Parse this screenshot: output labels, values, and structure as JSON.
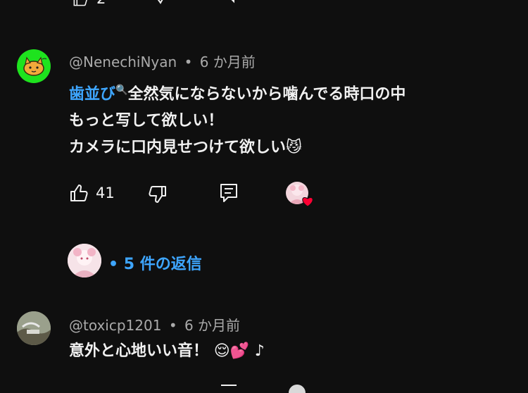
{
  "top_actions": {
    "like_count": "2"
  },
  "comments": [
    {
      "author": "@NenechiNyan",
      "separator": "•",
      "time": "6 か月前",
      "hashtag": "歯並び",
      "search_glyph": "🔍",
      "line1_rest": "全然気にならないから噛んでる時口の中",
      "line2": "もっと写して欲しい！",
      "line3": "カメラに口内見せつけて欲しい",
      "line3_emoji": "😼",
      "like_count": "41",
      "replies_label": "• 5 件の返信",
      "avatar_bg": "#1ee31e",
      "avatar_icon": "cat-icon",
      "heart_color": "#ff0033"
    },
    {
      "author": "@toxicp1201",
      "separator": "•",
      "time": "6 か月前",
      "text": "意外と心地いい音！",
      "emoji_1": "😌",
      "emoji_2": "💕",
      "emoji_3": "♪"
    }
  ],
  "colors": {
    "background": "#0f0f0f",
    "link": "#3ea6ff",
    "muted": "#aaaaaa"
  }
}
